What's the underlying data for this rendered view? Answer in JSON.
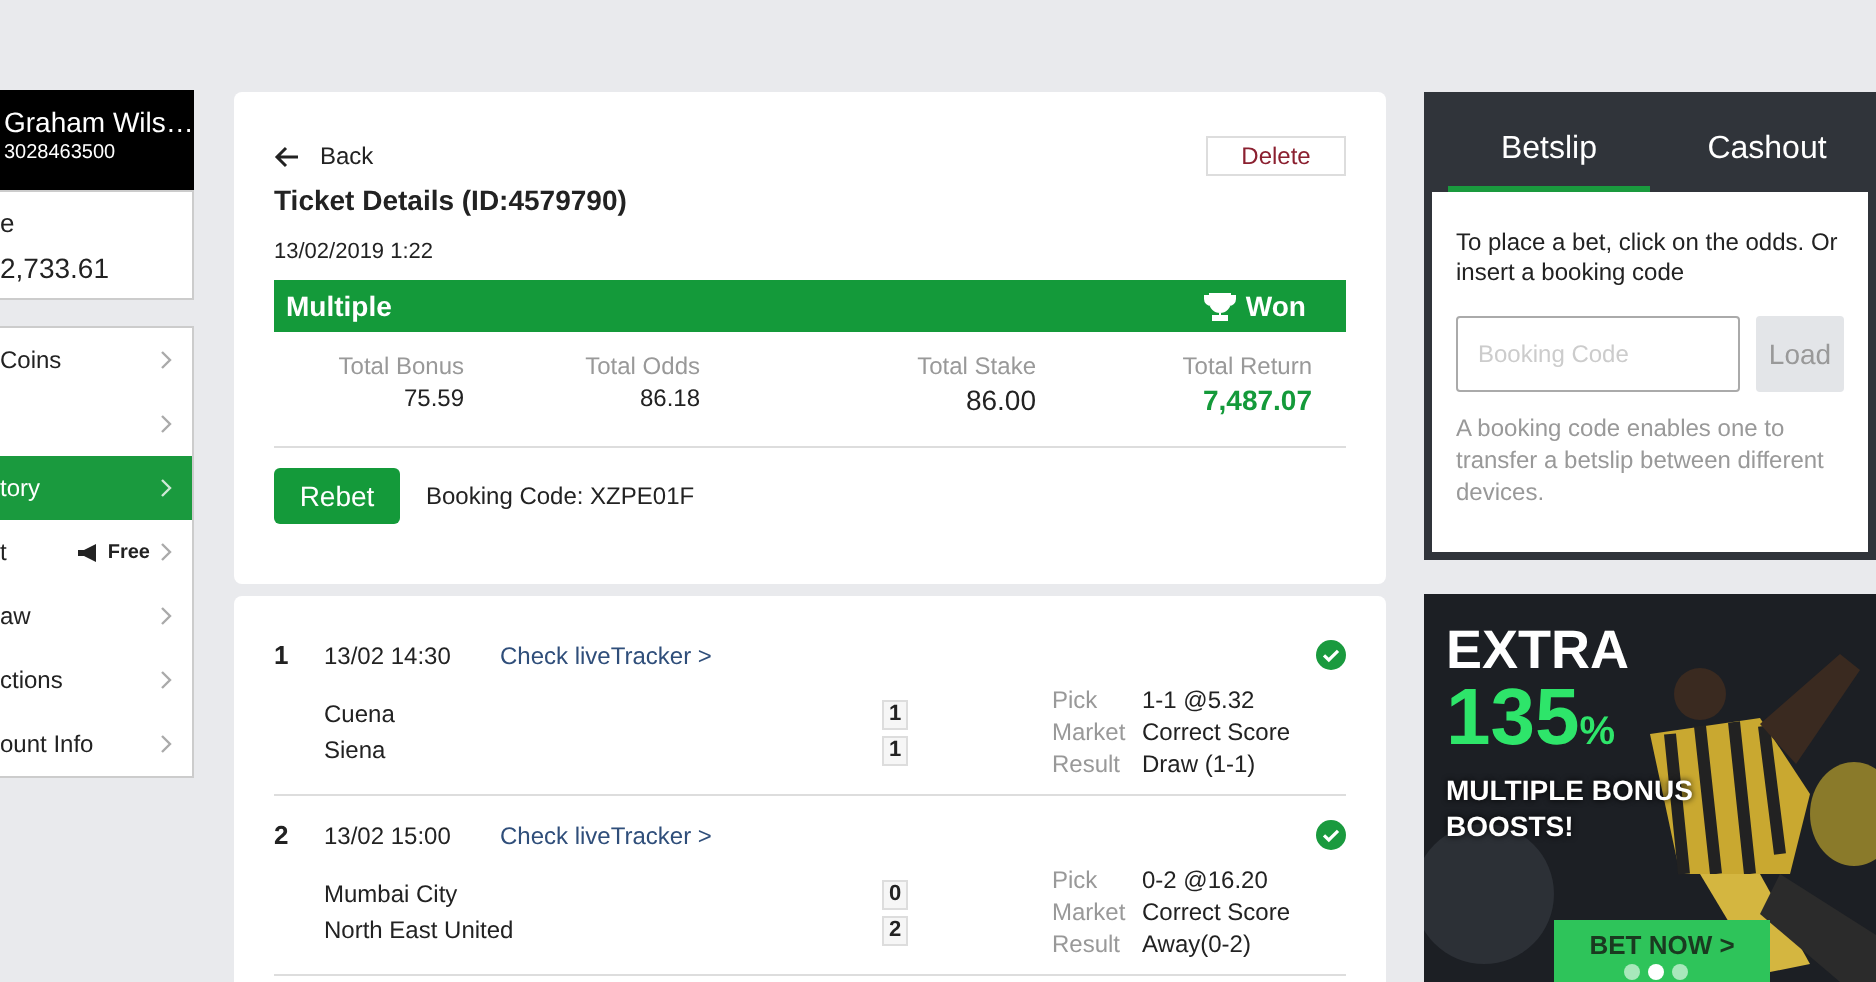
{
  "account": {
    "name": "Graham Wils…",
    "phone": "3028463500",
    "balance_label": "e",
    "balance": "2,733.61"
  },
  "menu": [
    {
      "label": "Coins",
      "selected": false
    },
    {
      "selected": false
    },
    {
      "label": "tory",
      "selected": true
    },
    {
      "label": "t",
      "selected": false,
      "badge": "Free"
    },
    {
      "label": "aw",
      "selected": false
    },
    {
      "label": "ctions",
      "selected": false
    },
    {
      "label": "ount Info",
      "selected": false
    }
  ],
  "ticket": {
    "back": "Back",
    "delete": "Delete",
    "title": "Ticket Details (ID:4579790)",
    "date": "13/02/2019 1:22",
    "type": "Multiple",
    "status": "Won",
    "totals": [
      {
        "label": "Total Bonus",
        "value": "75.59",
        "highlight": false
      },
      {
        "label": "Total Odds",
        "value": "86.18",
        "highlight": false
      },
      {
        "label": "Total Stake",
        "value": "86.00",
        "highlight": false
      },
      {
        "label": "Total Return",
        "value": "7,487.07",
        "highlight": true
      }
    ],
    "rebet": "Rebet",
    "booking_code": "Booking Code: XZPE01F"
  },
  "matches": [
    {
      "index": "1",
      "time": "13/02 14:30",
      "link": "Check liveTracker >",
      "won": true,
      "teams": [
        {
          "name": "Cuena",
          "score": "1"
        },
        {
          "name": "Siena",
          "score": "1"
        }
      ],
      "details": [
        {
          "label": "Pick",
          "value": "1-1 @5.32"
        },
        {
          "label": "Market",
          "value": "Correct Score"
        },
        {
          "label": "Result",
          "value": "Draw (1-1)"
        }
      ]
    },
    {
      "index": "2",
      "time": "13/02 15:00",
      "link": "Check liveTracker >",
      "won": true,
      "teams": [
        {
          "name": "Mumbai City",
          "score": "0"
        },
        {
          "name": "North East United",
          "score": "2"
        }
      ],
      "details": [
        {
          "label": "Pick",
          "value": "0-2 @16.20"
        },
        {
          "label": "Market",
          "value": "Correct Score"
        },
        {
          "label": "Result",
          "value": "Away(0-2)"
        }
      ]
    }
  ],
  "betslip": {
    "tabs": [
      {
        "label": "Betslip",
        "selected": true
      },
      {
        "label": "Cashout",
        "selected": false
      }
    ],
    "message": "To place a bet, click on the odds. Or insert a booking code",
    "placeholder": "Booking Code",
    "load": "Load",
    "hint": "A booking code enables one to transfer a betslip between different devices."
  },
  "banner": {
    "kind": "picture",
    "line1": "EXTRA",
    "line2": "135",
    "percent": "%",
    "line3": "MULTIPLE BONUS",
    "line4": "BOOSTS!",
    "cta": "BET NOW >",
    "dots": [
      {
        "selected": false
      },
      {
        "selected": true
      },
      {
        "selected": false
      }
    ]
  }
}
